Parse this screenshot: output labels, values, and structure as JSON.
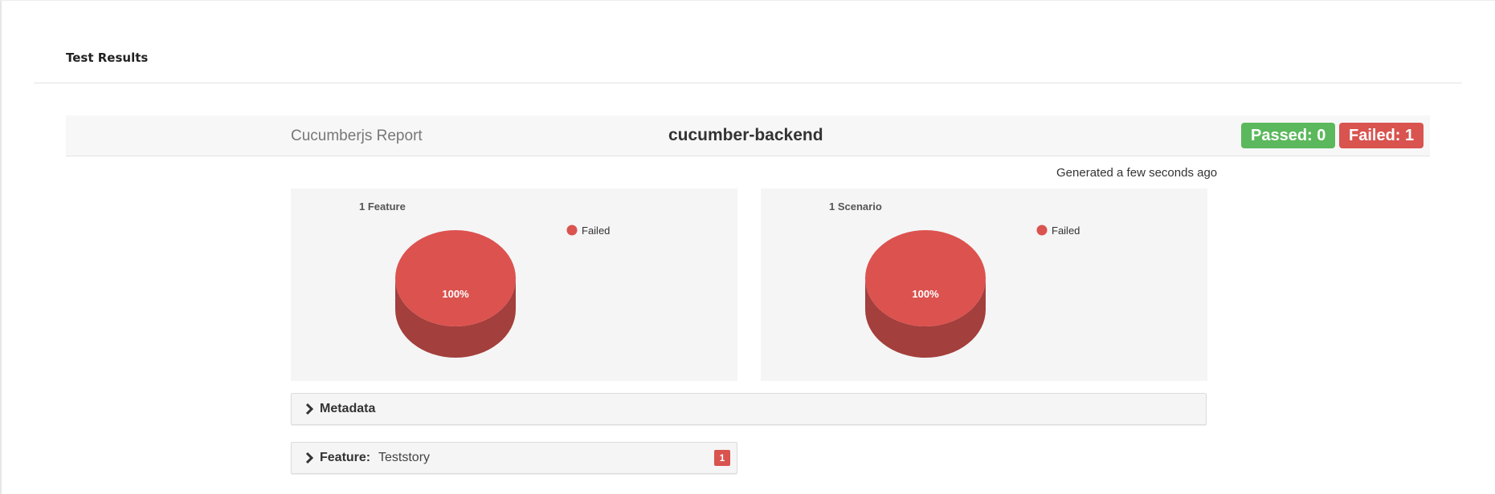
{
  "page": {
    "title": "Test Results"
  },
  "report": {
    "brand": "Cucumberjs Report",
    "project": "cucumber-backend",
    "passed_badge": "Passed: 0",
    "failed_badge": "Failed: 1",
    "generated": "Generated a few seconds ago"
  },
  "colors": {
    "passed": "#5cb85c",
    "failed": "#d9534f",
    "pie_top": "#dc524f",
    "pie_side": "#a33f3c"
  },
  "chart_data": [
    {
      "type": "pie",
      "title": "1 Feature",
      "categories": [
        "Failed"
      ],
      "values": [
        100
      ],
      "slice_labels": [
        "100%"
      ],
      "legend": "top-right"
    },
    {
      "type": "pie",
      "title": "1 Scenario",
      "categories": [
        "Failed"
      ],
      "values": [
        100
      ],
      "slice_labels": [
        "100%"
      ],
      "legend": "top-right"
    }
  ],
  "accordions": {
    "metadata": {
      "label": "Metadata",
      "icon": "chevron-right-icon"
    },
    "feature": {
      "label": "Feature:",
      "name": "Teststory",
      "count": "1",
      "icon": "chevron-right-icon"
    }
  }
}
